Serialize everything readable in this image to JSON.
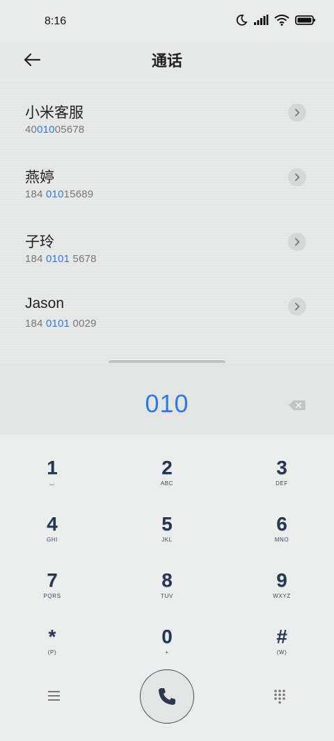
{
  "status": {
    "time": "8:16"
  },
  "header": {
    "title": "通话"
  },
  "results": [
    {
      "name": "小米客服",
      "pre": "400",
      "match": "10",
      "post": "05678",
      "pre2": "40",
      "match_full": "010"
    },
    {
      "name": "燕婷",
      "pre": "184 ",
      "match": "010",
      "post": "15689"
    },
    {
      "name": "子玲",
      "pre": "184 ",
      "match": "0101",
      "post": " 5678"
    },
    {
      "name": "Jason",
      "pre": "184 ",
      "match": "0101",
      "post": " 0029"
    }
  ],
  "dialer": {
    "input": "010"
  },
  "keys": [
    {
      "digit": "1",
      "letters": "⌴"
    },
    {
      "digit": "2",
      "letters": "ABC"
    },
    {
      "digit": "3",
      "letters": "DEF"
    },
    {
      "digit": "4",
      "letters": "GHI"
    },
    {
      "digit": "5",
      "letters": "JKL"
    },
    {
      "digit": "6",
      "letters": "MNO"
    },
    {
      "digit": "7",
      "letters": "PQRS"
    },
    {
      "digit": "8",
      "letters": "TUV"
    },
    {
      "digit": "9",
      "letters": "WXYZ"
    },
    {
      "digit": "*",
      "letters": "(P)"
    },
    {
      "digit": "0",
      "letters": "+"
    },
    {
      "digit": "#",
      "letters": "(W)"
    }
  ],
  "icons": {
    "back": "arrow-left-icon",
    "chevron": "chevron-right-icon",
    "backspace": "backspace-icon",
    "menu": "menu-icon",
    "call": "phone-icon",
    "keypad": "dialpad-icon"
  },
  "colors": {
    "accent": "#2f79e0",
    "key_text": "#27374f"
  }
}
